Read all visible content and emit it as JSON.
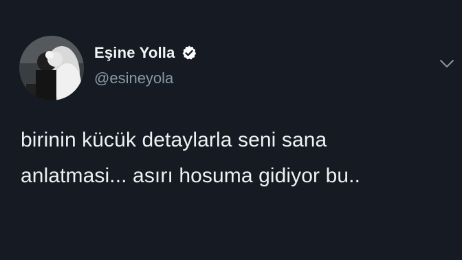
{
  "author": {
    "display_name": "Eşine Yolla",
    "handle": "@esineyola",
    "verified": true
  },
  "tweet": {
    "lines": [
      "birinin kücük detaylarla seni sana",
      "anlatmasi... asırı hosuma gidiyor bu.."
    ]
  },
  "icons": {
    "verified": "verified-badge-icon",
    "more": "chevron-down-icon"
  },
  "colors": {
    "background": "#151a23",
    "text": "#eef0f2",
    "handle": "#8b98a5",
    "verified_badge": "#ffffff"
  }
}
